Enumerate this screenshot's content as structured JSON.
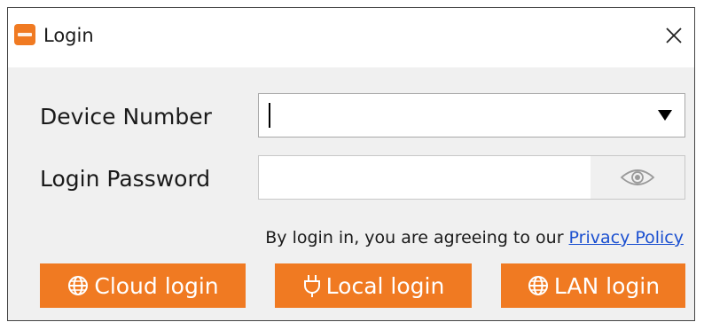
{
  "window": {
    "title": "Login",
    "app_icon": "app-logo-icon",
    "close_icon": "close-icon"
  },
  "form": {
    "device_number": {
      "label": "Device Number",
      "value": "",
      "dropdown_icon": "dropdown-arrow-icon"
    },
    "login_password": {
      "label": "Login Password",
      "value": "",
      "toggle_icon": "eye-icon"
    }
  },
  "agreement": {
    "text": "By login in, you are agreeing to our",
    "link_text": "Privacy Policy"
  },
  "buttons": {
    "cloud": {
      "label": "Cloud login",
      "icon": "globe-icon"
    },
    "local": {
      "label": "Local login",
      "icon": "plug-icon"
    },
    "lan": {
      "label": "LAN login",
      "icon": "globe-icon"
    }
  },
  "colors": {
    "accent": "#f07a22",
    "link": "#1a4fd0",
    "window_bg": "#f0f0f0",
    "titlebar_bg": "#ffffff"
  }
}
